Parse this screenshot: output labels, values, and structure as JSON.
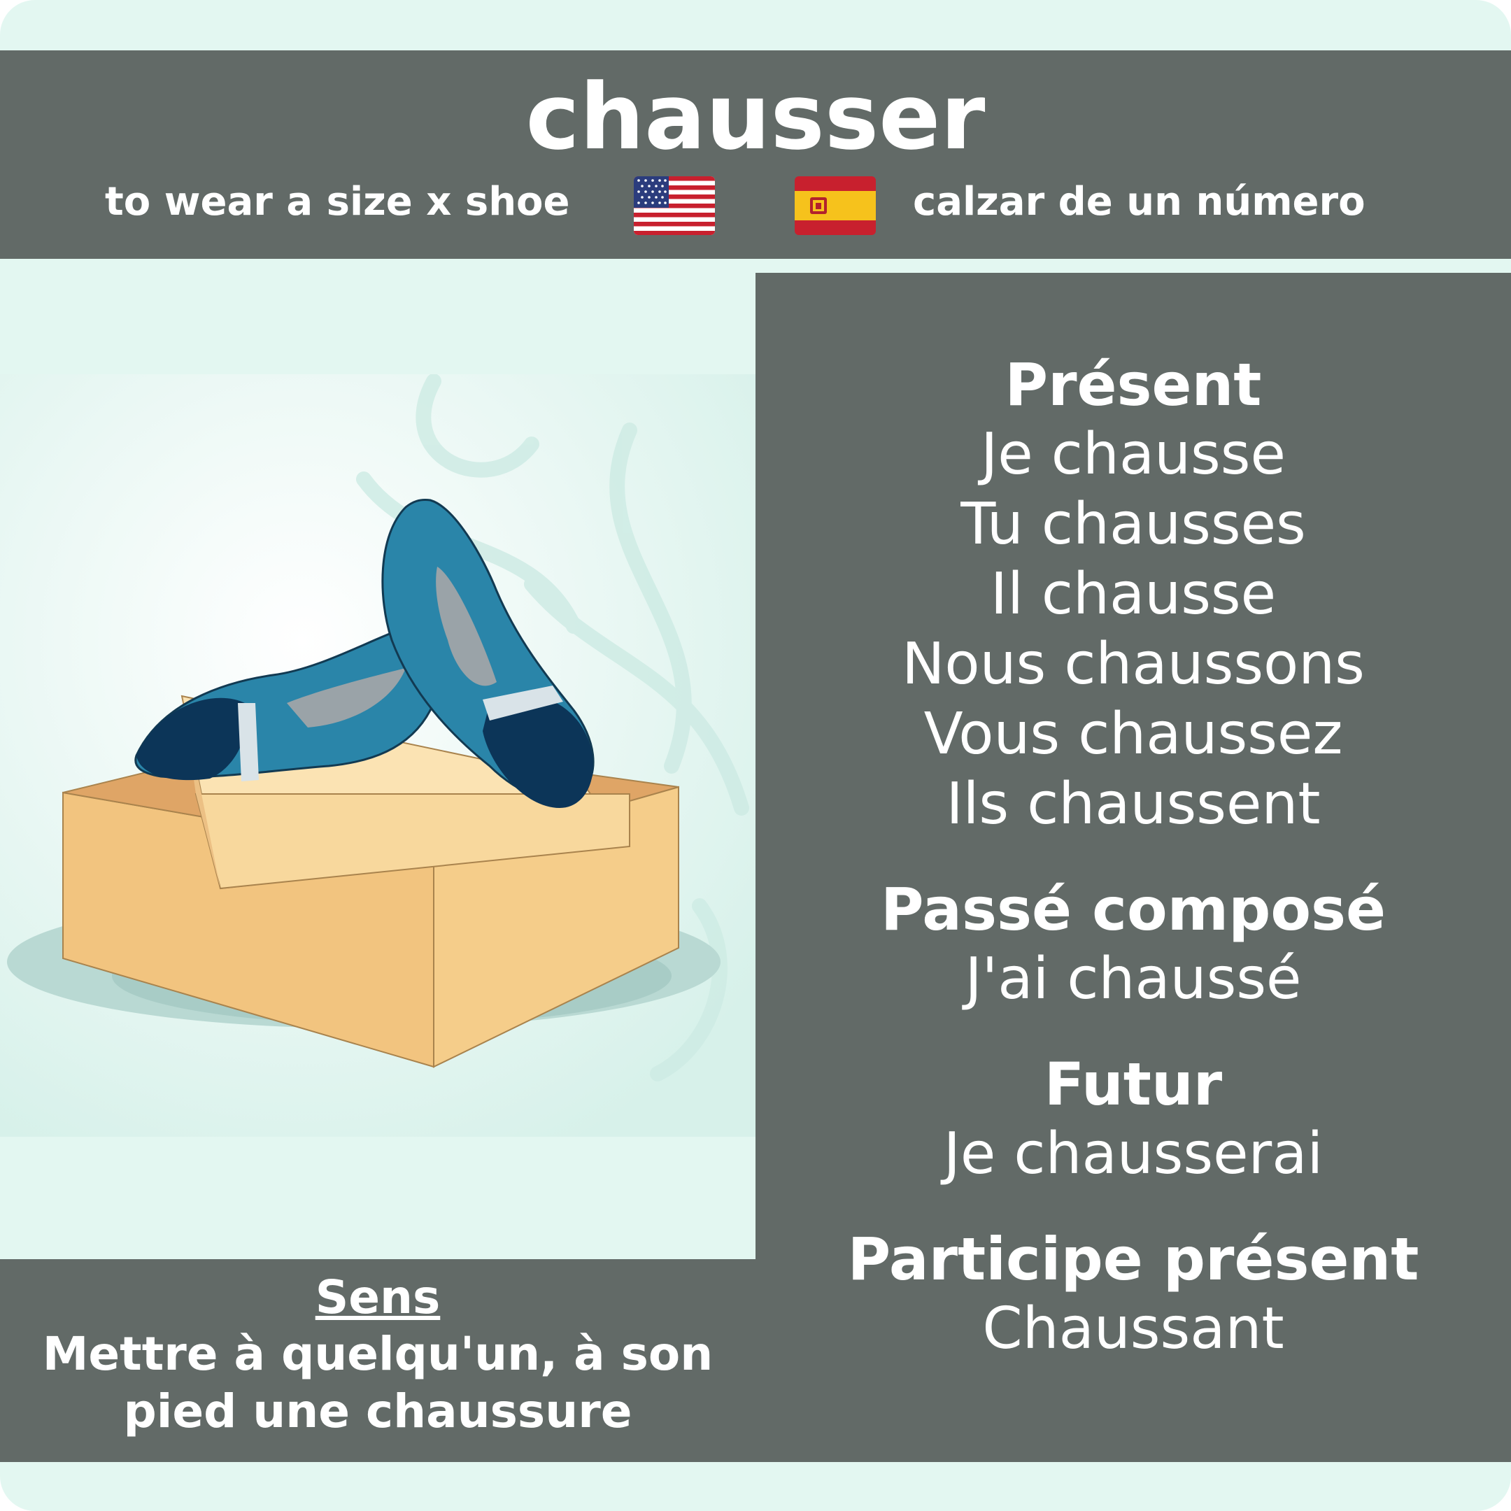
{
  "header": {
    "verb": "chausser",
    "english": "to wear a size x shoe",
    "spanish": "calzar de un número"
  },
  "flags": {
    "english_flag_icon": "us-flag-icon",
    "spanish_flag_icon": "spain-flag-icon"
  },
  "conjugation": {
    "present": {
      "title": "Présent",
      "forms": [
        "Je chausse",
        "Tu chausses",
        "Il chausse",
        "Nous chaussons",
        "Vous chaussez",
        "Ils chaussent"
      ]
    },
    "passe_compose": {
      "title": "Passé composé",
      "form": "J'ai chaussé"
    },
    "futur": {
      "title": "Futur",
      "form": "Je chausserai"
    },
    "participe_present": {
      "title": "Participe présent",
      "form": "Chaussant"
    }
  },
  "sens": {
    "title": "Sens",
    "definition": "Mettre à quelqu'un, à son pied une chaussure"
  },
  "colors": {
    "background": "#e3f7f1",
    "panel": "#626a67",
    "text": "#ffffff"
  }
}
